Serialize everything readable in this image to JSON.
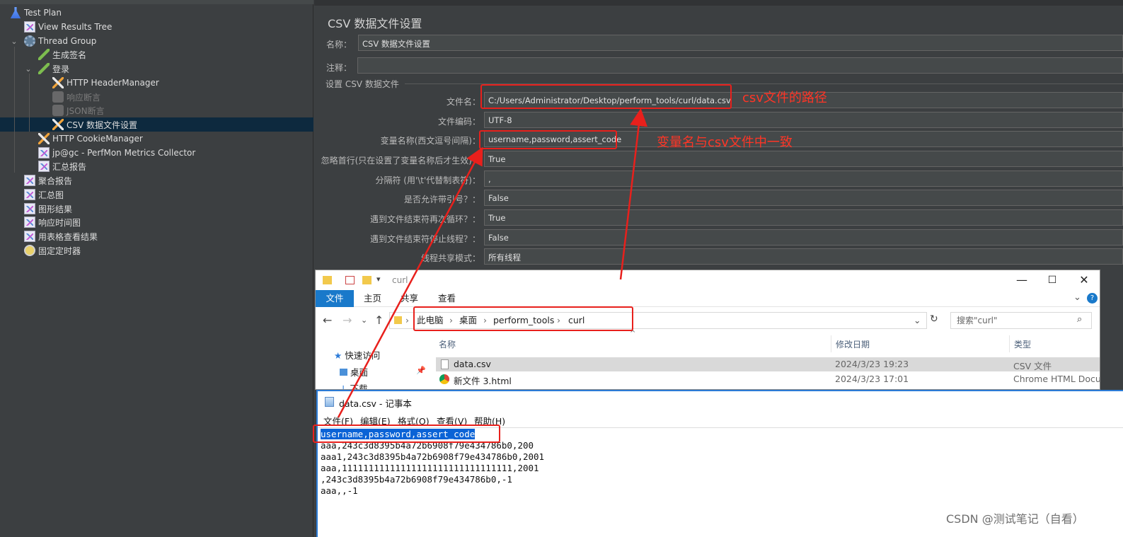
{
  "tree": {
    "items": [
      {
        "label": "Test Plan",
        "icon": "flask-icon",
        "disabled": false
      },
      {
        "label": "View Results Tree",
        "icon": "chart-icon",
        "disabled": false
      },
      {
        "label": "Thread Group",
        "icon": "gear-icon",
        "disabled": false
      },
      {
        "label": "生成签名",
        "icon": "pen-icon",
        "disabled": false
      },
      {
        "label": "登录",
        "icon": "pen-icon",
        "disabled": false
      },
      {
        "label": "HTTP HeaderManager",
        "icon": "tool-icon",
        "disabled": false
      },
      {
        "label": "响应断言",
        "icon": "grey-icon",
        "disabled": true
      },
      {
        "label": "JSON断言",
        "icon": "grey-icon",
        "disabled": true
      },
      {
        "label": "CSV 数据文件设置",
        "icon": "tool-icon",
        "disabled": false
      },
      {
        "label": "HTTP CookieManager",
        "icon": "tool-icon",
        "disabled": false
      },
      {
        "label": "jp@gc - PerfMon Metrics Collector",
        "icon": "chart-icon",
        "disabled": false
      },
      {
        "label": "汇总报告",
        "icon": "chart-icon",
        "disabled": false
      },
      {
        "label": "聚合报告",
        "icon": "chart-icon",
        "disabled": false
      },
      {
        "label": "汇总图",
        "icon": "chart-icon",
        "disabled": false
      },
      {
        "label": "图形结果",
        "icon": "chart-icon",
        "disabled": false
      },
      {
        "label": "响应时间图",
        "icon": "chart-icon",
        "disabled": false
      },
      {
        "label": "用表格查看结果",
        "icon": "chart-icon",
        "disabled": false
      },
      {
        "label": "固定定时器",
        "icon": "timer-icon",
        "disabled": false
      }
    ]
  },
  "panel": {
    "title": "CSV 数据文件设置",
    "name_label": "名称：",
    "name_value": "CSV 数据文件设置",
    "comment_label": "注释：",
    "comment_value": "",
    "group_title": "设置 CSV 数据文件",
    "fields": [
      {
        "label": "文件名：",
        "value": "C:/Users/Administrator/Desktop/perform_tools/curl/data.csv"
      },
      {
        "label": "文件编码：",
        "value": "UTF-8"
      },
      {
        "label": "变量名称(西文逗号间隔)：",
        "value": "username,password,assert_code"
      },
      {
        "label": "忽略首行(只在设置了变量名称后才生效)：",
        "value": "True"
      },
      {
        "label": "分隔符 (用'\\t'代替制表符)：",
        "value": ","
      },
      {
        "label": "是否允许带引号？：",
        "value": "False"
      },
      {
        "label": "遇到文件结束符再次循环？：",
        "value": "True"
      },
      {
        "label": "遇到文件结束符停止线程？：",
        "value": "False"
      },
      {
        "label": "线程共享模式：",
        "value": "所有线程"
      }
    ]
  },
  "annotations": {
    "path_note": "csv文件的路径",
    "vars_note": "变量名与csv文件中一致",
    "color": "#e8201c"
  },
  "explorer": {
    "title": "curl",
    "ribbon_tabs": [
      "文件",
      "主页",
      "共享",
      "查看"
    ],
    "breadcrumb": [
      "此电脑",
      "桌面",
      "perform_tools",
      "curl"
    ],
    "search_placeholder": "搜索\"curl\"",
    "columns": [
      "名称",
      "修改日期",
      "类型"
    ],
    "nav": {
      "quick_access": "快速访问",
      "desktop": "桌面",
      "downloads": "下载"
    },
    "files": [
      {
        "name": "data.csv",
        "date": "2024/3/23 19:23",
        "type": "CSV 文件"
      },
      {
        "name": "新文件 3.html",
        "date": "2024/3/23 17:01",
        "type": "Chrome HTML Docun"
      }
    ]
  },
  "notepad": {
    "title": "data.csv - 记事本",
    "menu": [
      "文件(F)",
      "编辑(E)",
      "格式(O)",
      "查看(V)",
      "帮助(H)"
    ],
    "selected_line": "username,password,assert_code",
    "lines": [
      "aaa,243c3d8395b4a72b6908f79e434786b0,200",
      "aaa1,243c3d8395b4a72b6908f79e434786b0,2001",
      "aaa,11111111111111111111111111111111,2001",
      ",243c3d8395b4a72b6908f79e434786b0,-1",
      "aaa,,-1"
    ]
  },
  "watermark": "CSDN @测试笔记（自看）"
}
